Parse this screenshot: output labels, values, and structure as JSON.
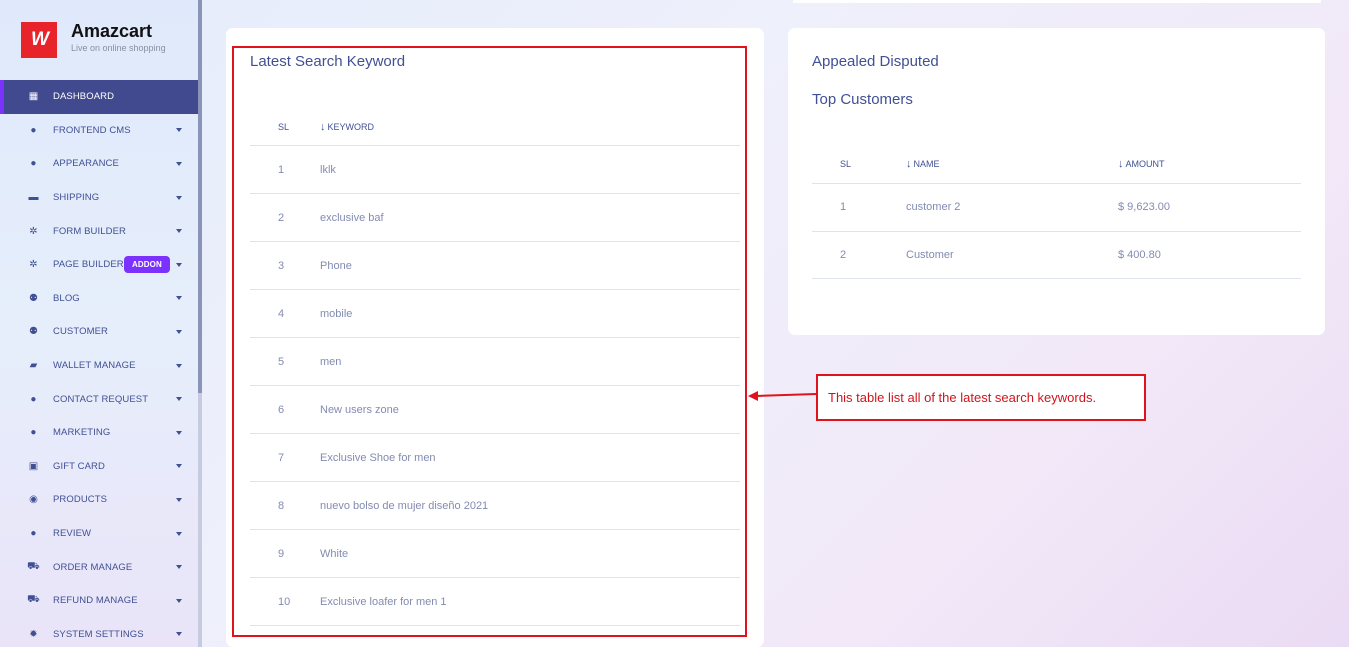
{
  "brand": {
    "name": "Amazcart",
    "tagline": "Live on online shopping",
    "logo_glyph": "W",
    "color": "#e8232a"
  },
  "sidebar": {
    "items": [
      {
        "label": "DASHBOARD",
        "icon": "grid-icon",
        "active": true
      },
      {
        "label": "FRONTEND CMS",
        "icon": "user-icon"
      },
      {
        "label": "APPEARANCE",
        "icon": "user-icon"
      },
      {
        "label": "SHIPPING",
        "icon": "money-icon"
      },
      {
        "label": "FORM BUILDER",
        "icon": "cogs-icon"
      },
      {
        "label": "PAGE BUILDER",
        "icon": "cogs-icon",
        "badge": "ADDON"
      },
      {
        "label": "BLOG",
        "icon": "users-icon"
      },
      {
        "label": "CUSTOMER",
        "icon": "users-icon"
      },
      {
        "label": "WALLET MANAGE",
        "icon": "wallet-icon"
      },
      {
        "label": "CONTACT REQUEST",
        "icon": "user-icon"
      },
      {
        "label": "MARKETING",
        "icon": "user-icon"
      },
      {
        "label": "GIFT CARD",
        "icon": "gift-icon"
      },
      {
        "label": "PRODUCTS",
        "icon": "product-icon"
      },
      {
        "label": "REVIEW",
        "icon": "user-icon"
      },
      {
        "label": "ORDER MANAGE",
        "icon": "cart-icon"
      },
      {
        "label": "REFUND MANAGE",
        "icon": "cart-icon"
      },
      {
        "label": "SYSTEM SETTINGS",
        "icon": "gear-icon"
      }
    ]
  },
  "keywords_card": {
    "title": "Latest Search Keyword",
    "columns": {
      "sl": "SL",
      "keyword": "KEYWORD"
    },
    "rows": [
      {
        "sl": "1",
        "keyword": "lklk"
      },
      {
        "sl": "2",
        "keyword": "exclusive baf"
      },
      {
        "sl": "3",
        "keyword": "Phone"
      },
      {
        "sl": "4",
        "keyword": "mobile"
      },
      {
        "sl": "5",
        "keyword": "men"
      },
      {
        "sl": "6",
        "keyword": "New users zone"
      },
      {
        "sl": "7",
        "keyword": "Exclusive Shoe for men"
      },
      {
        "sl": "8",
        "keyword": "nuevo bolso de mujer diseño 2021"
      },
      {
        "sl": "9",
        "keyword": "White"
      },
      {
        "sl": "10",
        "keyword": "Exclusive loafer for men 1"
      }
    ]
  },
  "customers_card": {
    "heading": "Appealed Disputed",
    "title": "Top Customers",
    "columns": {
      "sl": "SL",
      "name": "NAME",
      "amount": "AMOUNT"
    },
    "rows": [
      {
        "sl": "1",
        "name": "customer 2",
        "amount": "$ 9,623.00"
      },
      {
        "sl": "2",
        "name": "Customer",
        "amount": "$ 400.80"
      }
    ]
  },
  "annotation": {
    "text": "This table list all of the latest search keywords.",
    "color": "#e0121b"
  },
  "colors": {
    "accent": "#7c32ff",
    "active_bg": "#414a8e",
    "text": "#415094",
    "muted": "#828bb2"
  }
}
